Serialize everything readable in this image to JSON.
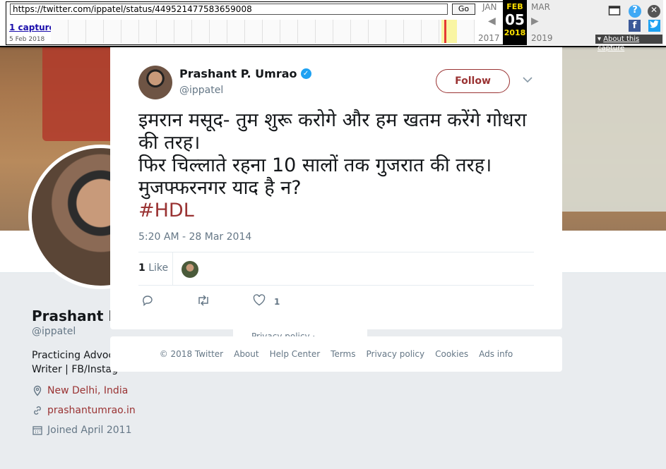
{
  "wayback": {
    "url": "https://twitter.com/ippatel/status/449521477583659008",
    "go_label": "Go",
    "captures": "1 capture",
    "capture_date": "5 Feb 2018",
    "prev_month": "JAN",
    "prev_year": "2017",
    "cur_month": "FEB",
    "cur_day": "05",
    "cur_year": "2018",
    "next_month": "MAR",
    "next_year": "2019",
    "about": "About this capture"
  },
  "profile": {
    "name": "Prashant P.",
    "handle": "@ippatel",
    "bio_line1": "Practicing Advoca",
    "bio_line2": "Writer | FB/Instag",
    "location": "New Delhi, India",
    "website": "prashantumrao.in",
    "joined": "Joined April 2011",
    "side_links": "Privacy policy · Cookies"
  },
  "tweet": {
    "name": "Prashant P. Umrao",
    "handle": "@ippatel",
    "follow_label": "Follow",
    "line1": "इमरान मसूद- तुम शुरू करोगे और हम खतम करेंगे गोधरा की तरह।",
    "line2": "फिर चिल्लाते रहना 10 सालों तक गुजरात की तरह।",
    "line3": "मुजफ्फरनगर याद है न?",
    "hashtag": "#HDL",
    "timestamp": "5:20 AM - 28 Mar 2014",
    "like_count": "1",
    "like_label": "Like",
    "action_like_count": "1"
  },
  "footer": {
    "copyright": "© 2018 Twitter",
    "links": [
      "About",
      "Help Center",
      "Terms",
      "Privacy policy",
      "Cookies",
      "Ads info"
    ]
  },
  "colors": {
    "link": "#9a3333",
    "verified": "#1da1f2",
    "muted": "#657786"
  }
}
